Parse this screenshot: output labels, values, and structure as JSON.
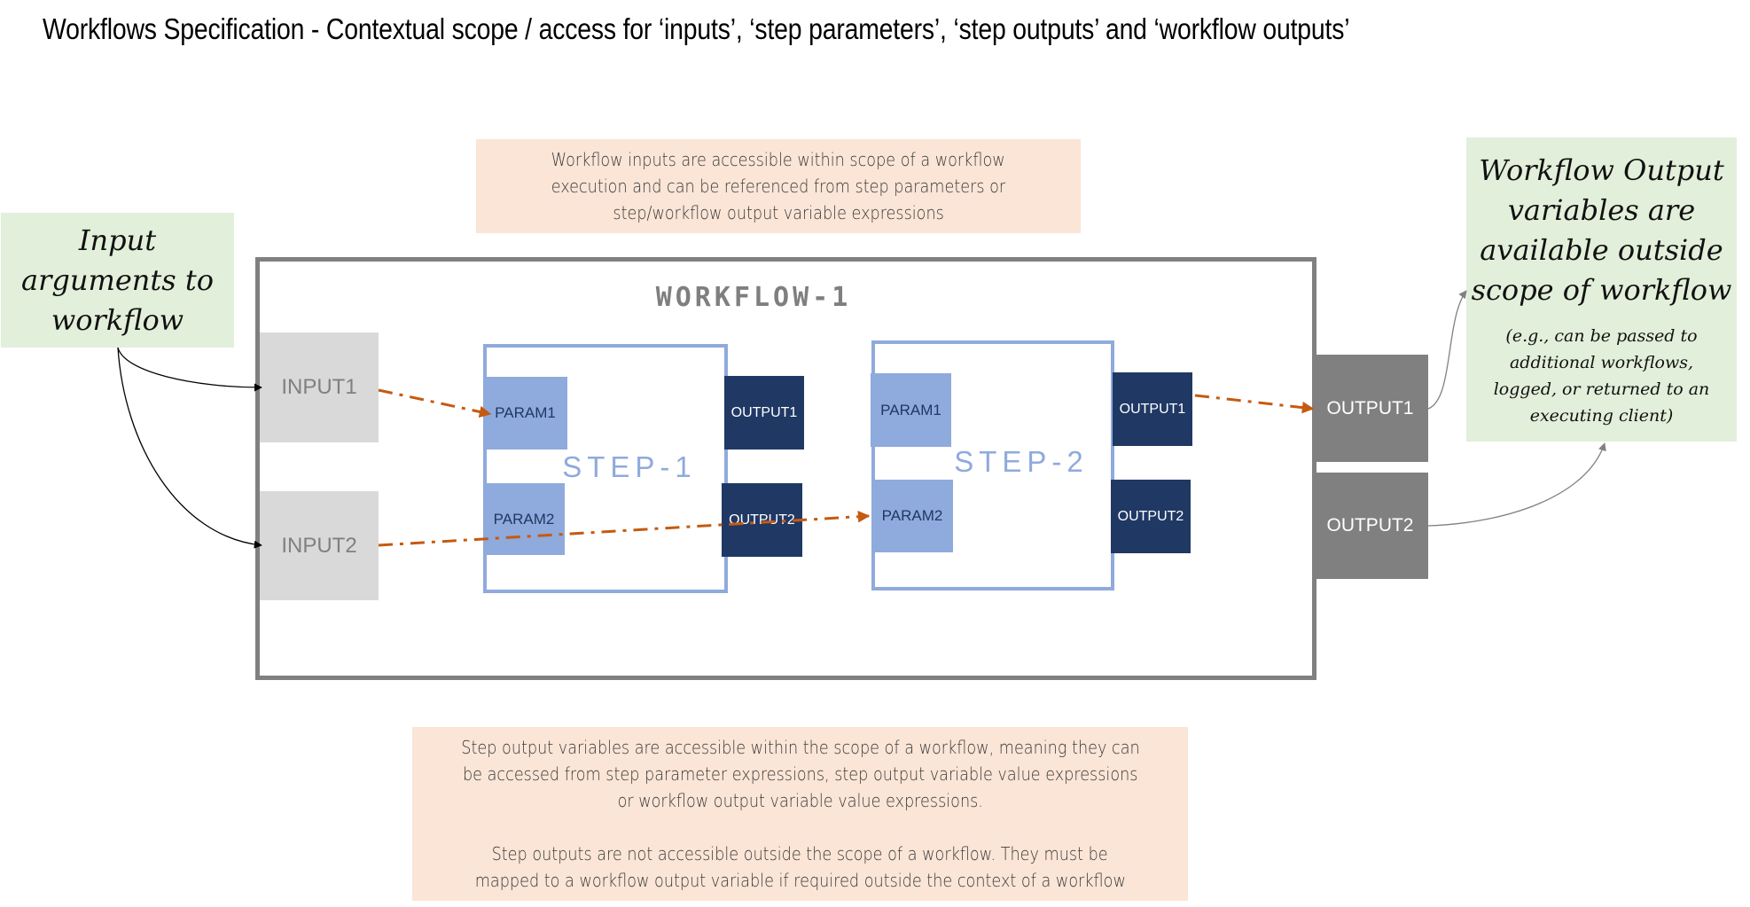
{
  "title": "Workflows Specification - Contextual scope / access for ‘inputs’, ‘step parameters’, ‘step outputs’ and ‘workflow outputs’",
  "notes": {
    "inputs_note": [
      "Workflow inputs are accessible within scope of a workflow",
      "execution and can be referenced from step parameters or",
      "step/workflow output variable expressions"
    ],
    "step_outputs_note": {
      "paragraph1": [
        "Step output variables are accessible within the scope of a workflow, meaning they can",
        "be accessed from step parameter expressions, step output variable value expressions",
        "or workflow output variable value expressions."
      ],
      "paragraph2": [
        "Step outputs are not accessible outside the scope of a workflow. They must be",
        "mapped to a workflow output variable if required outside the context of a workflow"
      ]
    }
  },
  "callouts": {
    "input_args": [
      "Input",
      "arguments to",
      "workflow"
    ],
    "workflow_outputs": {
      "heading": [
        "Workflow Output",
        "variables are",
        "available outside",
        "scope of workflow"
      ],
      "detail": [
        "(e.g., can be passed to",
        "additional workflows,",
        "logged, or returned to an",
        "executing client)"
      ]
    }
  },
  "workflow": {
    "label": "WORKFLOW-1",
    "inputs": [
      "INPUT1",
      "INPUT2"
    ],
    "steps": [
      {
        "label": "STEP-1",
        "params": [
          "PARAM1",
          "PARAM2"
        ],
        "outputs": [
          "OUTPUT1",
          "OUTPUT2"
        ]
      },
      {
        "label": "STEP-2",
        "params": [
          "PARAM1",
          "PARAM2"
        ],
        "outputs": [
          "OUTPUT1",
          "OUTPUT2"
        ]
      }
    ],
    "outputs": [
      "OUTPUT1",
      "OUTPUT2"
    ]
  },
  "connections": [
    {
      "from": "input-args-callout",
      "to": "INPUT1",
      "style": "solid-black"
    },
    {
      "from": "input-args-callout",
      "to": "INPUT2",
      "style": "solid-black"
    },
    {
      "from": "INPUT1",
      "to": "STEP-1.PARAM1",
      "style": "dash-dot-orange"
    },
    {
      "from": "INPUT2",
      "to": "STEP-2.PARAM2",
      "style": "dash-dot-orange"
    },
    {
      "from": "STEP-2.OUTPUT1",
      "to": "WORKFLOW-1.OUTPUT1",
      "style": "dash-dot-orange"
    },
    {
      "from": "WORKFLOW-1.OUTPUT1",
      "to": "workflow-outputs-callout",
      "style": "solid-gray"
    },
    {
      "from": "WORKFLOW-1.OUTPUT2",
      "to": "workflow-outputs-callout",
      "style": "solid-gray"
    }
  ],
  "colors": {
    "note_bg": "#fbe5d6",
    "callout_bg": "#e2efda",
    "workflow_border": "#808080",
    "input_bg": "#d9d9d9",
    "step_border": "#8faadc",
    "param_bg": "#8faadc",
    "step_output_bg": "#203864",
    "workflow_output_bg": "#808080",
    "mapping_arrow": "#c55a11"
  }
}
